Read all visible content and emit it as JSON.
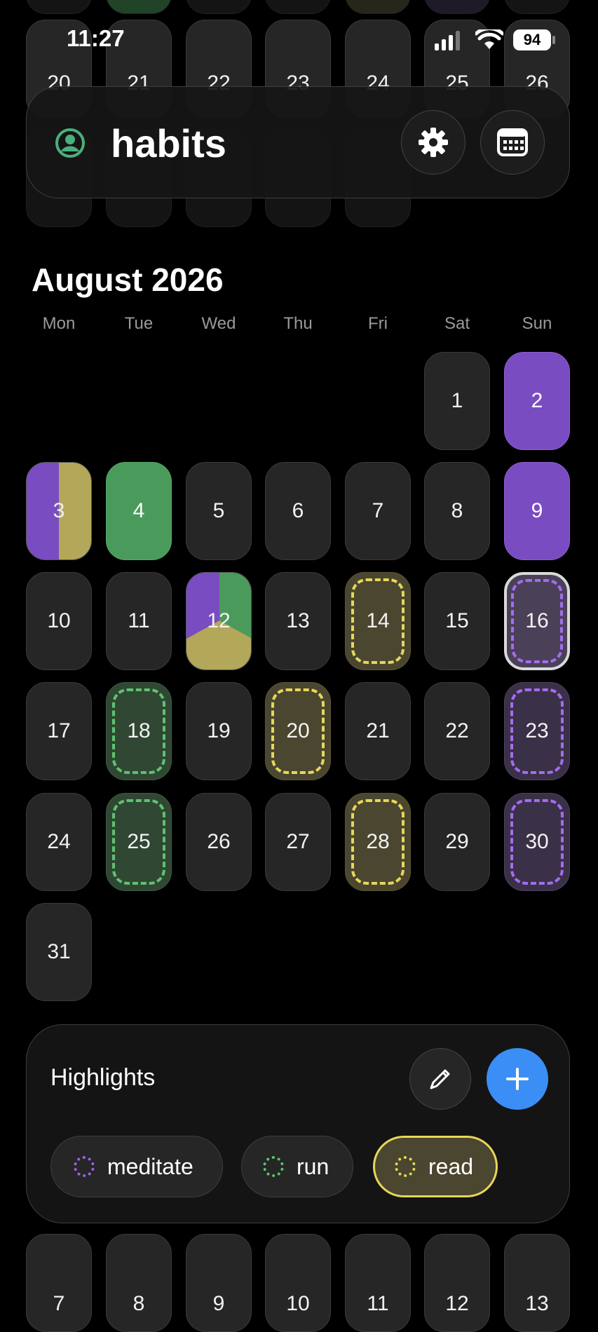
{
  "status": {
    "time": "11:27",
    "battery": "94"
  },
  "header": {
    "title": "habits",
    "profile_icon": "person-circle-icon",
    "settings_icon": "gear-icon",
    "calendar_icon": "calendar-icon"
  },
  "prev_week_numbers": [
    "20",
    "21",
    "22",
    "23",
    "24",
    "25",
    "26"
  ],
  "calendar": {
    "month_title": "August 2026",
    "weekdays": [
      "Mon",
      "Tue",
      "Wed",
      "Thu",
      "Fri",
      "Sat",
      "Sun"
    ],
    "days": [
      "1",
      "2",
      "3",
      "4",
      "5",
      "6",
      "7",
      "8",
      "9",
      "10",
      "11",
      "12",
      "13",
      "14",
      "15",
      "16",
      "17",
      "18",
      "19",
      "20",
      "21",
      "22",
      "23",
      "24",
      "25",
      "26",
      "27",
      "28",
      "29",
      "30",
      "31"
    ],
    "colors": {
      "meditate": "#7a4cc1",
      "run": "#4a9a5c",
      "read": "#b3a75a"
    }
  },
  "next_week_numbers": [
    "7",
    "8",
    "9",
    "10",
    "11",
    "12",
    "13"
  ],
  "highlights": {
    "title": "Highlights",
    "habits": [
      {
        "label": "meditate",
        "color": "#9b63e8"
      },
      {
        "label": "run",
        "color": "#5fc26f"
      },
      {
        "label": "read",
        "color": "#e6d75a"
      }
    ]
  }
}
